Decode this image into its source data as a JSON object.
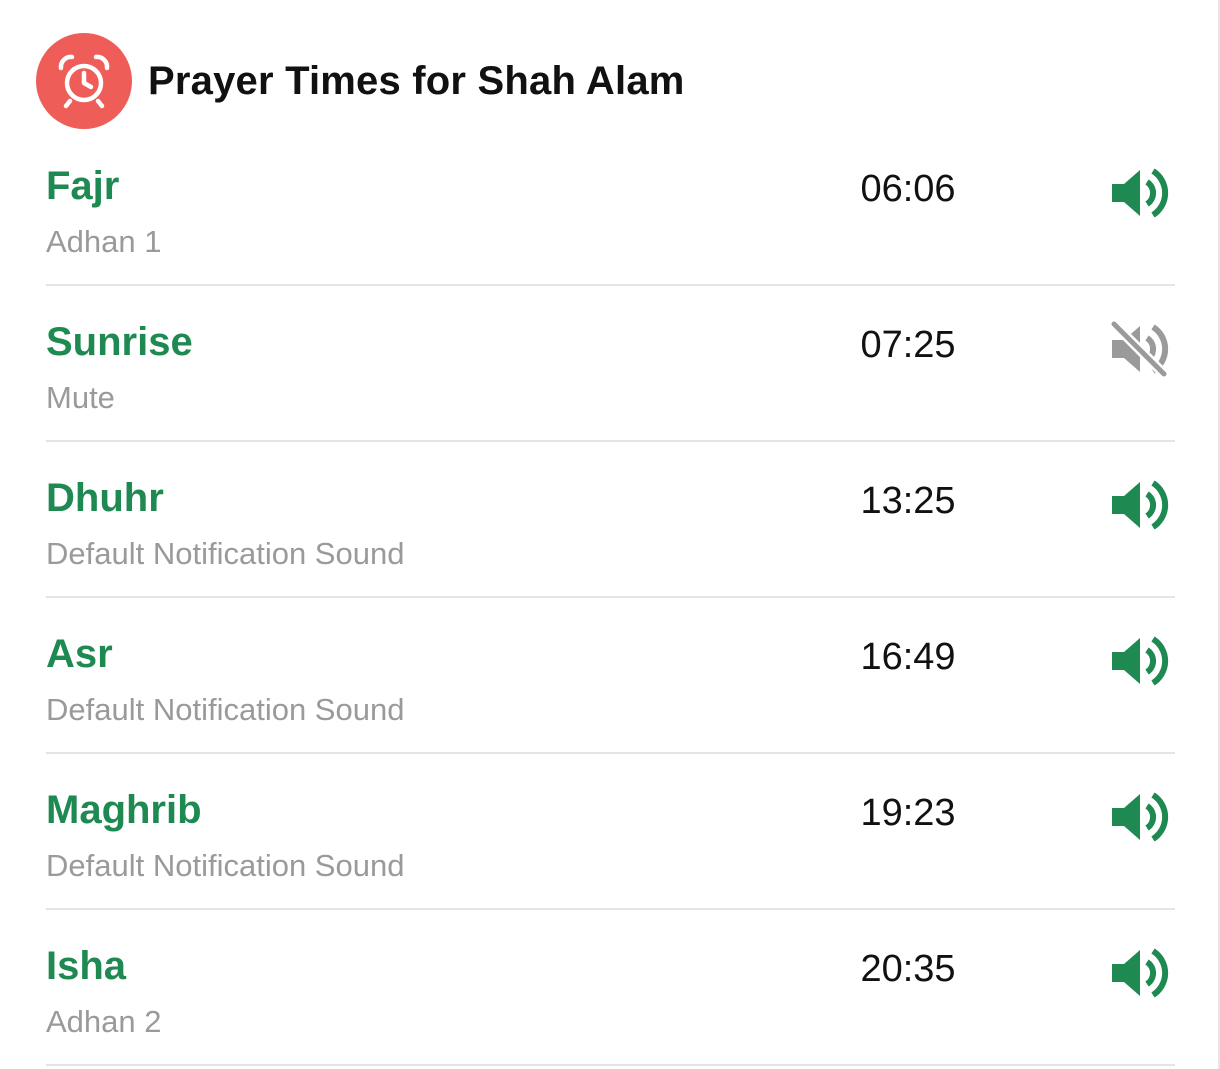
{
  "header": {
    "title": "Prayer Times for Shah Alam",
    "icon": "alarm-clock-icon",
    "icon_color": "#ee5d58"
  },
  "accent_color": "#1e8a52",
  "muted_color": "#9a9a9a",
  "prayers": [
    {
      "name": "Fajr",
      "sound": "Adhan 1",
      "time": "06:06",
      "state": "on",
      "icon": "speaker-icon"
    },
    {
      "name": "Sunrise",
      "sound": "Mute",
      "time": "07:25",
      "state": "muted",
      "icon": "speaker-muted-icon"
    },
    {
      "name": "Dhuhr",
      "sound": "Default Notification Sound",
      "time": "13:25",
      "state": "on",
      "icon": "speaker-icon"
    },
    {
      "name": "Asr",
      "sound": "Default Notification Sound",
      "time": "16:49",
      "state": "on",
      "icon": "speaker-icon"
    },
    {
      "name": "Maghrib",
      "sound": "Default Notification Sound",
      "time": "19:23",
      "state": "on",
      "icon": "speaker-icon"
    },
    {
      "name": "Isha",
      "sound": "Adhan 2",
      "time": "20:35",
      "state": "on",
      "icon": "speaker-icon"
    }
  ]
}
